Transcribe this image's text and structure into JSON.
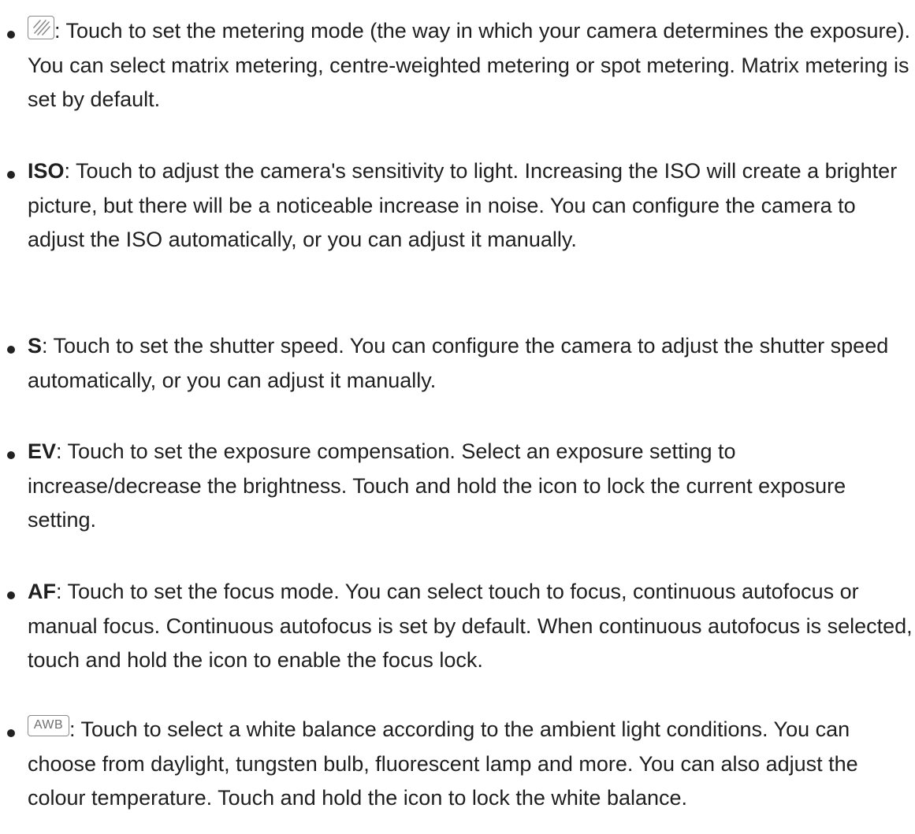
{
  "items": [
    {
      "icon": "metering-mode-icon",
      "term": "",
      "text": ": Touch to set the metering mode (the way in which your camera determines the exposure). You can select matrix metering, centre-weighted metering or spot metering. Matrix metering is set by default."
    },
    {
      "term": "ISO",
      "text": ": Touch to adjust the camera's sensitivity to light. Increasing the ISO will create a brighter picture, but there will be a noticeable increase in noise. You can configure the camera to adjust the ISO automatically, or you can adjust it manually."
    },
    {
      "term": "S",
      "text": ": Touch to set the shutter speed. You can configure the camera to adjust the shutter speed automatically, or you can adjust it manually."
    },
    {
      "term": "EV",
      "text": ": Touch to set the exposure compensation. Select an exposure setting to increase/decrease the brightness. Touch and hold the icon to lock the current exposure setting."
    },
    {
      "term": "AF",
      "text": ": Touch to set the focus mode. You can select touch to focus, continuous autofocus or manual focus. Continuous autofocus is set by default. When continuous autofocus is selected, touch and hold the icon to enable the focus lock."
    },
    {
      "icon": "white-balance-icon",
      "icon_label": "AWB",
      "text": ": Touch to select a white balance according to the ambient light conditions. You can choose from daylight, tungsten bulb, fluorescent lamp and more. You can also adjust the colour temperature. Touch and hold the icon to lock the white balance."
    }
  ]
}
